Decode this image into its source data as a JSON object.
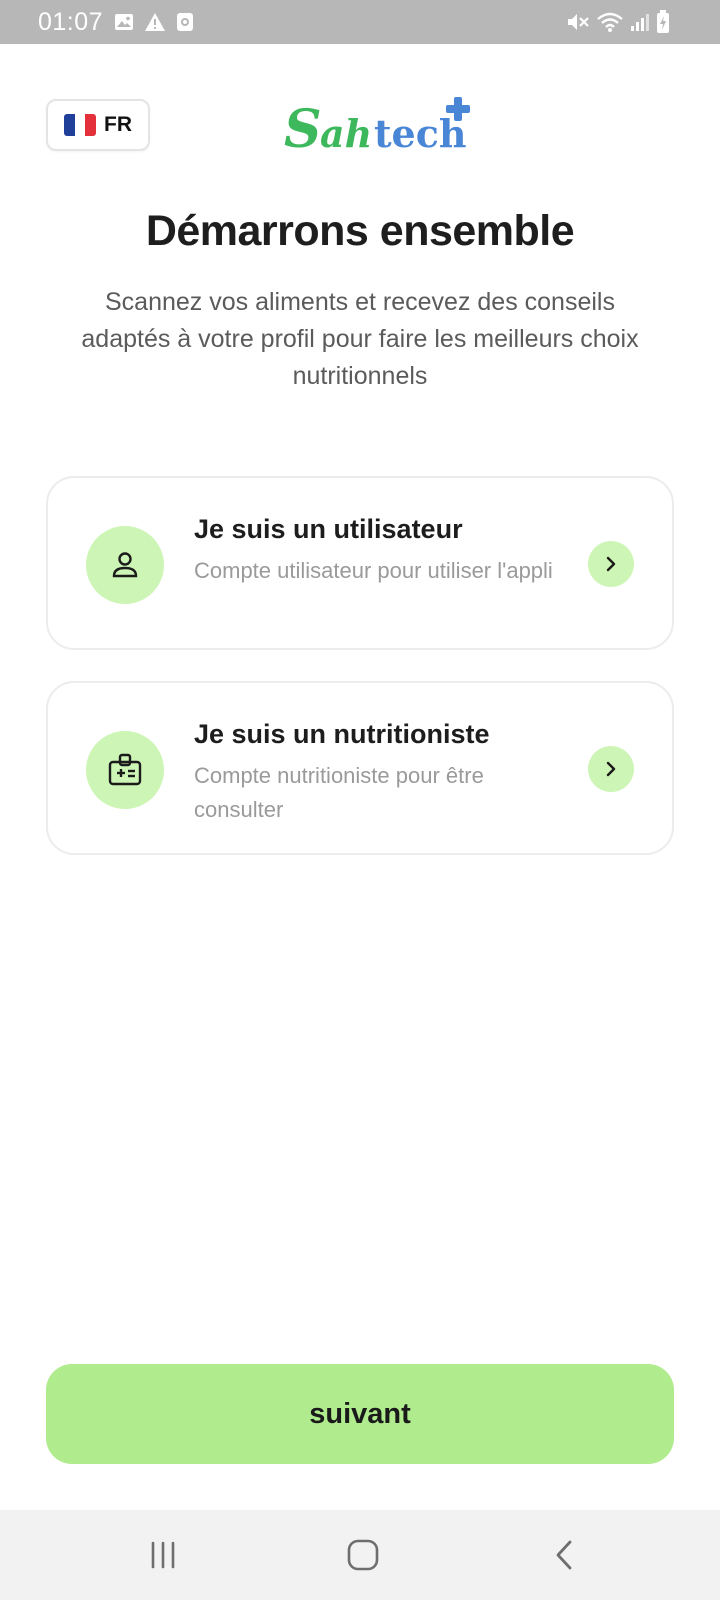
{
  "status_bar": {
    "time": "01:07",
    "left_icons": [
      "image-icon",
      "warning-icon",
      "camera-icon"
    ],
    "right_icons": [
      "mute-icon",
      "wifi-icon",
      "signal-icon",
      "battery-charging-icon"
    ]
  },
  "header": {
    "language": {
      "flag": "france-flag-icon",
      "code": "FR"
    },
    "logo_text": "Sahtech",
    "logo_colors": {
      "green": "#3db85c",
      "blue": "#4a86d6"
    }
  },
  "title": "Démarrons ensemble",
  "subtitle": "Scannez vos aliments et recevez des conseils adaptés à votre profil pour faire les meilleurs choix nutritionnels",
  "options": [
    {
      "icon": "person-icon",
      "title": "Je suis un utilisateur",
      "description": "Compte utilisateur pour utiliser l'appli"
    },
    {
      "icon": "medical-badge-icon",
      "title": "Je suis un nutritioniste",
      "description": "Compte nutritioniste pour être consulter"
    }
  ],
  "next_button": {
    "label": "suivant"
  },
  "colors": {
    "accent_light": "#cdf5b5",
    "button": "#b0ec8e",
    "status_bar": "#b7b7b7"
  },
  "nav_bar": {
    "buttons": [
      "recents-icon",
      "home-icon",
      "back-icon"
    ]
  }
}
